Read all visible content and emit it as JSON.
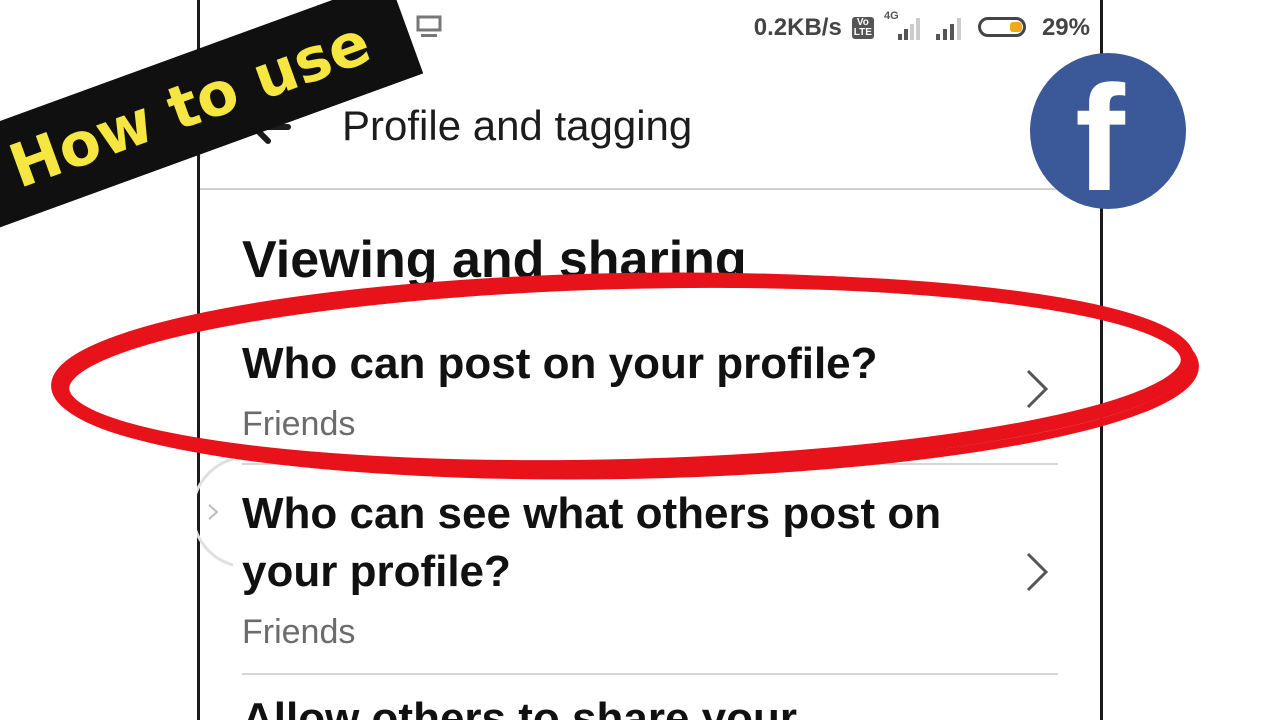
{
  "overlay": {
    "banner_text": "How to use",
    "logo_letter": "f",
    "accent_color": "#e8121b",
    "banner_color": "#f5e642",
    "logo_color": "#3b5998"
  },
  "status_bar": {
    "net_speed": "0.2KB/s",
    "volte": "Vo\nLTE",
    "network": "4G",
    "battery_percent": "29%",
    "battery_level": 0.29
  },
  "app_bar": {
    "title": "Profile and tagging"
  },
  "section": {
    "title": "Viewing and sharing"
  },
  "rows": [
    {
      "label": "Who can post on your profile?",
      "value": "Friends"
    },
    {
      "label": "Who can see what others post on your profile?",
      "value": "Friends"
    },
    {
      "label": "Allow others to share your"
    }
  ]
}
